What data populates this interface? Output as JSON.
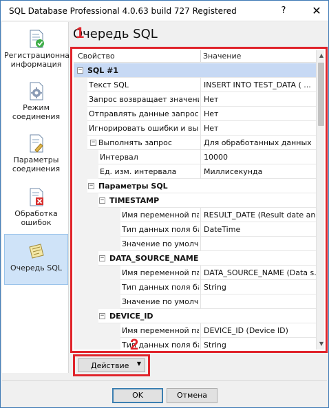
{
  "window": {
    "title": "SQL Database Professional 4.0.63 build 727 Registered",
    "help_glyph": "?",
    "close_glyph": "✕"
  },
  "sidebar": {
    "items": [
      {
        "label": "Регистрационная информация",
        "icon": "registration-check-icon"
      },
      {
        "label": "Режим соединения",
        "icon": "connection-gear-icon"
      },
      {
        "label": "Параметры соединения",
        "icon": "connection-params-icon"
      },
      {
        "label": "Обработка ошибок",
        "icon": "error-handling-icon"
      },
      {
        "label": "Очередь SQL",
        "icon": "sql-queue-icon",
        "active": true
      }
    ]
  },
  "page_title": "Очередь SQL",
  "annotations": {
    "mark1": "1",
    "mark2": "2"
  },
  "grid": {
    "header": {
      "property": "Свойство",
      "value": "Значение"
    },
    "rows": [
      {
        "type": "category",
        "level": 0,
        "label": "SQL #1",
        "expander": "−",
        "selected": true
      },
      {
        "type": "prop",
        "level": 0,
        "name": "Текст SQL",
        "value": "INSERT INTO TEST_DATA ( ..."
      },
      {
        "type": "prop",
        "level": 0,
        "name": "Запрос возвращает значения",
        "value": "Нет"
      },
      {
        "type": "prop",
        "level": 0,
        "name": "Отправлять данные запроса...",
        "value": "Нет"
      },
      {
        "type": "prop",
        "level": 0,
        "name": "Игнорировать ошибки и вып...",
        "value": "Нет"
      },
      {
        "type": "prop-group",
        "level": 0,
        "name": "Выполнять запрос",
        "expander": "−",
        "value": "Для обработанных данных"
      },
      {
        "type": "prop",
        "level": 1,
        "name": "Интервал",
        "value": "10000"
      },
      {
        "type": "prop",
        "level": 1,
        "name": "Ед. изм. интервала",
        "value": "Миллисекунда"
      },
      {
        "type": "category",
        "level": 1,
        "label": "Параметры SQL",
        "expander": "−"
      },
      {
        "type": "category",
        "level": 2,
        "label": "TIMESTAMP",
        "expander": "−"
      },
      {
        "type": "prop",
        "level": 3,
        "name": "Имя переменной парс...",
        "value": "RESULT_DATE (Result date an..."
      },
      {
        "type": "prop",
        "level": 3,
        "name": "Тип данных поля базы...",
        "value": "DateTime"
      },
      {
        "type": "prop",
        "level": 3,
        "name": "Значение по умолчанию",
        "value": ""
      },
      {
        "type": "category",
        "level": 2,
        "label": "DATA_SOURCE_NAME",
        "expander": "−"
      },
      {
        "type": "prop",
        "level": 3,
        "name": "Имя переменной парс...",
        "value": "DATA_SOURCE_NAME (Data s..."
      },
      {
        "type": "prop",
        "level": 3,
        "name": "Тип данных поля базы...",
        "value": "String"
      },
      {
        "type": "prop",
        "level": 3,
        "name": "Значение по умолчанию",
        "value": ""
      },
      {
        "type": "category",
        "level": 2,
        "label": "DEVICE_ID",
        "expander": "−"
      },
      {
        "type": "prop",
        "level": 3,
        "name": "Имя переменной парс...",
        "value": "DEVICE_ID (Device ID)"
      },
      {
        "type": "prop",
        "level": 3,
        "name": "Тип данных поля базы...",
        "value": "String"
      }
    ]
  },
  "scroll": {
    "up_glyph": "▲",
    "down_glyph": "▼"
  },
  "action": {
    "label": "Действие",
    "arrow": "▼"
  },
  "footer": {
    "ok_label": "OK",
    "cancel_label": "Отмена"
  },
  "colors": {
    "highlight_frame": "#e0242b",
    "selected_row": "#c7d9f4",
    "active_side": "#cfe3f8"
  }
}
